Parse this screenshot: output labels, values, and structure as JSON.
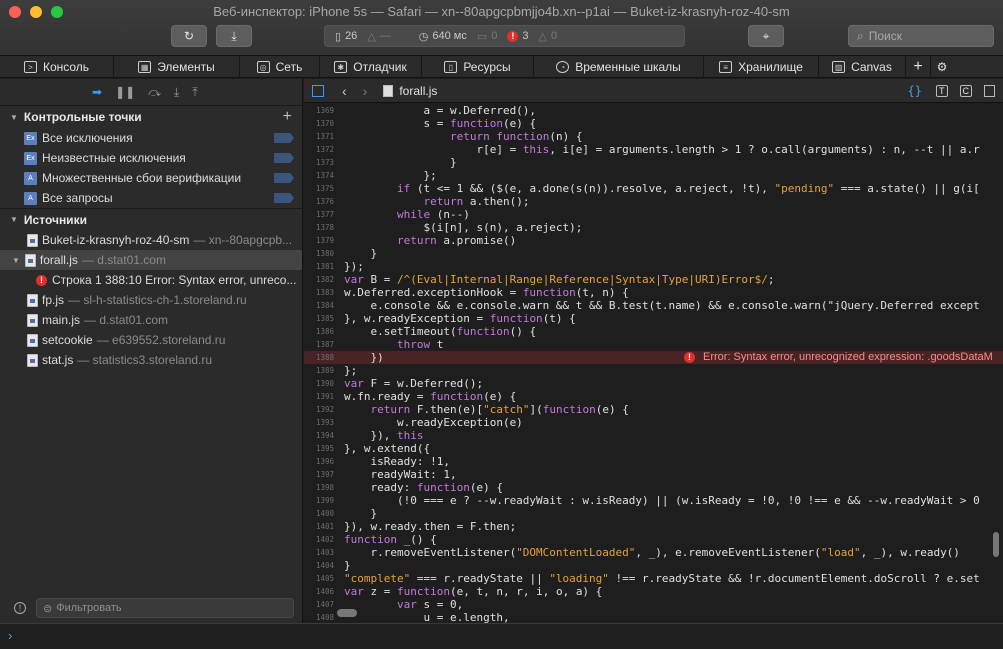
{
  "window": {
    "title": "Веб-инспектор: iPhone 5s — Safari — xn--80apgcpbmjjo4b.xn--p1ai — Buket-iz-krasnyh-roz-40-sm"
  },
  "toolbar": {
    "resources": "26",
    "load_time": "640 мс",
    "logs": "0",
    "errors": "3",
    "warnings": "0",
    "search_placeholder": "Поиск"
  },
  "tabs": [
    {
      "label": "Консоль",
      "icon": "console-icon"
    },
    {
      "label": "Элементы",
      "icon": "elements-icon"
    },
    {
      "label": "Сеть",
      "icon": "network-icon"
    },
    {
      "label": "Отладчик",
      "icon": "debugger-icon"
    },
    {
      "label": "Ресурсы",
      "icon": "resources-icon"
    },
    {
      "label": "Временные шкалы",
      "icon": "timeline-icon"
    },
    {
      "label": "Хранилище",
      "icon": "storage-icon"
    },
    {
      "label": "Canvas",
      "icon": "canvas-icon"
    }
  ],
  "sidebar": {
    "breakpoints_title": "Контрольные точки",
    "breakpoints": [
      {
        "label": "Все исключения",
        "icon": "Ex"
      },
      {
        "label": "Неизвестные исключения",
        "icon": "Ex"
      },
      {
        "label": "Множественные сбои верификации",
        "icon": "A"
      },
      {
        "label": "Все запросы",
        "icon": "A"
      }
    ],
    "sources_title": "Источники",
    "sources": [
      {
        "name": "Buket-iz-krasnyh-roz-40-sm",
        "host": "— xn--80apgcpb..."
      },
      {
        "name": "forall.js",
        "host": "— d.stat01.com"
      },
      {
        "name": "fp.js",
        "host": "— sl-h-statistics-ch-1.storeland.ru"
      },
      {
        "name": "main.js",
        "host": "— d.stat01.com"
      },
      {
        "name": "setcookie",
        "host": "— e639552.storeland.ru"
      },
      {
        "name": "stat.js",
        "host": "— statistics3.storeland.ru"
      }
    ],
    "error_item": "Строка 1 388:10 Error: Syntax error, unreco...",
    "filter_placeholder": "Фильтровать"
  },
  "editor": {
    "filename": "forall.js",
    "error_message": "Error: Syntax error, unrecognized expression: .goodsDataM",
    "lines": [
      {
        "n": "1369",
        "code": "            a = w.Deferred(),"
      },
      {
        "n": "1370",
        "code": "            s = function(e) {"
      },
      {
        "n": "1371",
        "code": "                return function(n) {"
      },
      {
        "n": "1372",
        "code": "                    r[e] = this, i[e] = arguments.length > 1 ? o.call(arguments) : n, --t || a.r"
      },
      {
        "n": "1373",
        "code": "                }"
      },
      {
        "n": "1374",
        "code": "            };"
      },
      {
        "n": "1375",
        "code": "        if (t <= 1 && ($(e, a.done(s(n)).resolve, a.reject, !t), \"pending\" === a.state() || g(i["
      },
      {
        "n": "1376",
        "code": "            return a.then();"
      },
      {
        "n": "1377",
        "code": "        while (n--)"
      },
      {
        "n": "1378",
        "code": "            $(i[n], s(n), a.reject);"
      },
      {
        "n": "1379",
        "code": "        return a.promise()"
      },
      {
        "n": "1380",
        "code": "    }"
      },
      {
        "n": "1381",
        "code": "});"
      },
      {
        "n": "1382",
        "code": "var B = /^(Eval|Internal|Range|Reference|Syntax|Type|URI)Error$/;"
      },
      {
        "n": "1383",
        "code": "w.Deferred.exceptionHook = function(t, n) {"
      },
      {
        "n": "1384",
        "code": "    e.console && e.console.warn && t && B.test(t.name) && e.console.warn(\"jQuery.Deferred except"
      },
      {
        "n": "1385",
        "code": "}, w.readyException = function(t) {"
      },
      {
        "n": "1386",
        "code": "    e.setTimeout(function() {"
      },
      {
        "n": "1387",
        "code": "        throw t"
      },
      {
        "n": "1388",
        "code": "    })"
      },
      {
        "n": "1389",
        "code": "};"
      },
      {
        "n": "1390",
        "code": "var F = w.Deferred();"
      },
      {
        "n": "1391",
        "code": "w.fn.ready = function(e) {"
      },
      {
        "n": "1392",
        "code": "    return F.then(e)[\"catch\"](function(e) {"
      },
      {
        "n": "1393",
        "code": "        w.readyException(e)"
      },
      {
        "n": "1394",
        "code": "    }), this"
      },
      {
        "n": "1395",
        "code": "}, w.extend({"
      },
      {
        "n": "1396",
        "code": "    isReady: !1,"
      },
      {
        "n": "1397",
        "code": "    readyWait: 1,"
      },
      {
        "n": "1398",
        "code": "    ready: function(e) {"
      },
      {
        "n": "1399",
        "code": "        (!0 === e ? --w.readyWait : w.isReady) || (w.isReady = !0, !0 !== e && --w.readyWait > 0"
      },
      {
        "n": "1400",
        "code": "    }"
      },
      {
        "n": "1401",
        "code": "}), w.ready.then = F.then;"
      },
      {
        "n": "1402",
        "code": "function _() {"
      },
      {
        "n": "1403",
        "code": "    r.removeEventListener(\"DOMContentLoaded\", _), e.removeEventListener(\"load\", _), w.ready()"
      },
      {
        "n": "1404",
        "code": "}"
      },
      {
        "n": "1405",
        "code": "\"complete\" === r.readyState || \"loading\" !== r.readyState && !r.documentElement.doScroll ? e.set"
      },
      {
        "n": "1406",
        "code": "var z = function(e, t, n, r, i, o, a) {"
      },
      {
        "n": "1407",
        "code": "        var s = 0,"
      },
      {
        "n": "1408",
        "code": "            u = e.length,"
      }
    ]
  },
  "console": {
    "prompt": "›"
  }
}
